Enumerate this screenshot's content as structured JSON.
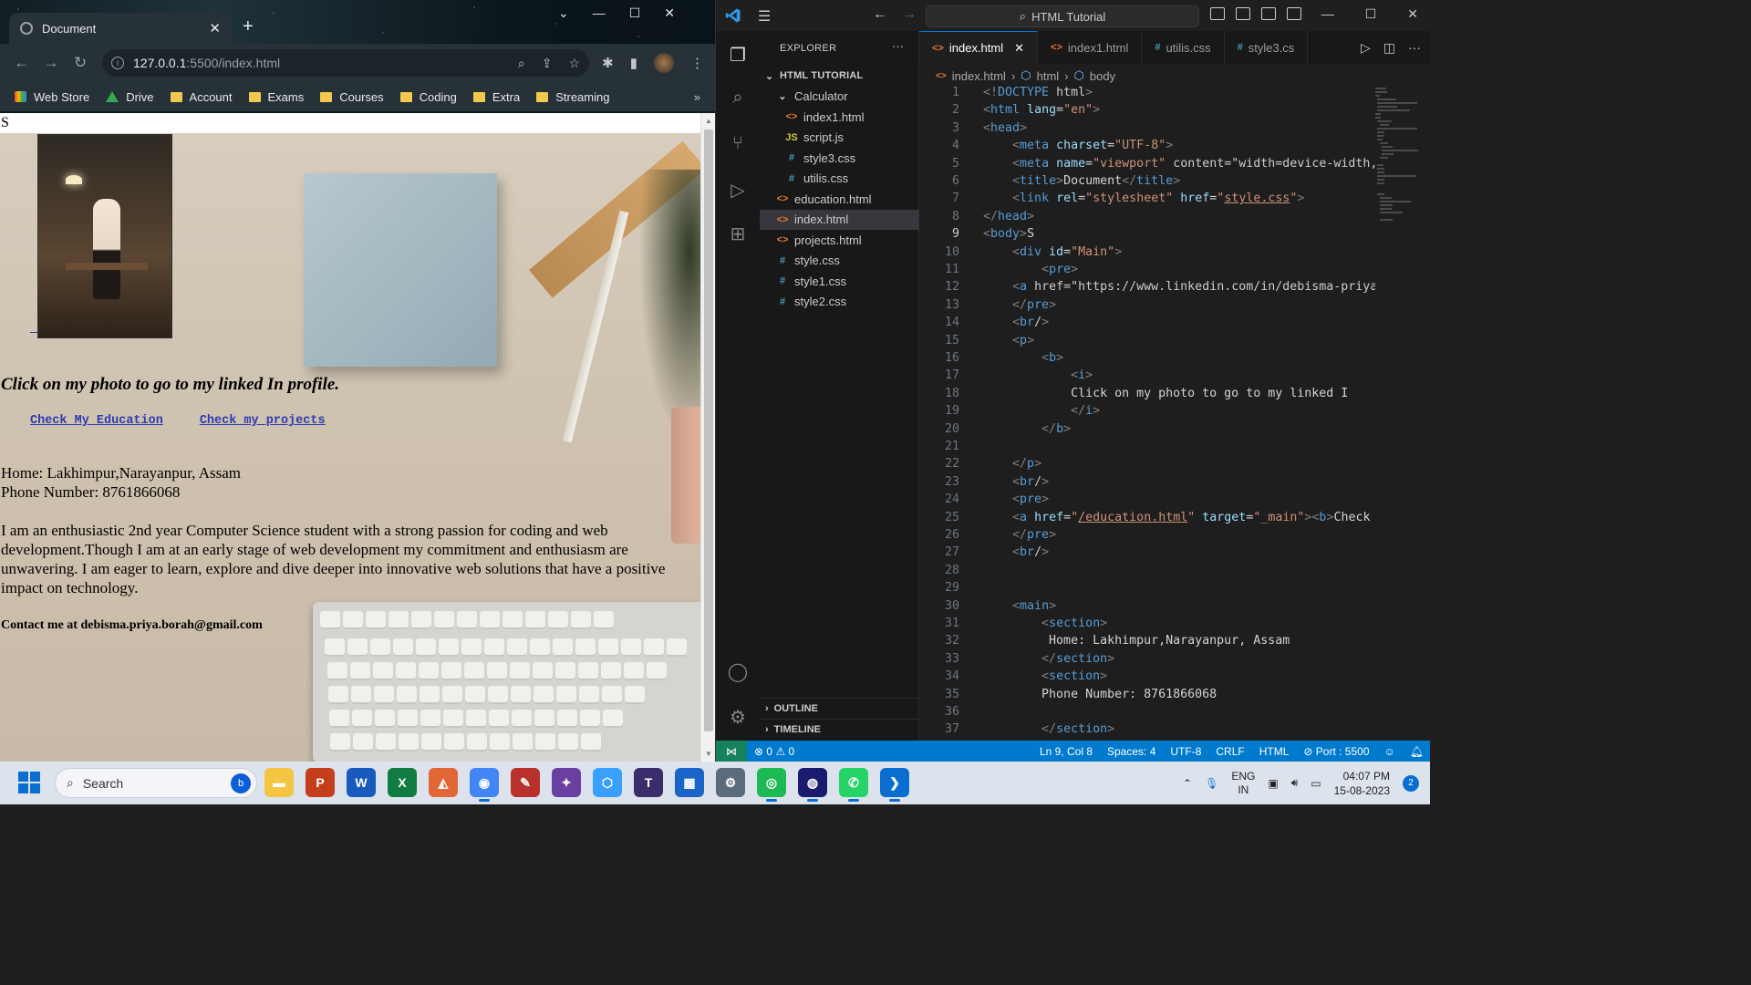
{
  "browser": {
    "tab_title": "Document",
    "url_host": "127.0.0.1",
    "url_path": ":5500/index.html",
    "bookmarks": [
      "Web Store",
      "Drive",
      "Account",
      "Exams",
      "Courses",
      "Coding",
      "Extra",
      "Streaming"
    ],
    "bookmarks_more": "»"
  },
  "page": {
    "body_text": "S",
    "intro": "Click on my photo to go to my linked In profile.",
    "link_education": "Check My Education",
    "link_projects": "Check my projects",
    "home": "Home: Lakhimpur,Narayanpur, Assam",
    "phone": "Phone Number: 8761866068",
    "about": "I am an enthusiastic 2nd year Computer Science student with a strong passion for coding and web development.Though I am at an early stage of web development my commitment and enthusiasm are unwavering. I am eager to learn, explore and dive deeper into innovative web solutions that have a positive impact on technology.",
    "contact": "Contact me at debisma.priya.borah@gmail.com"
  },
  "vscode": {
    "command_center": "HTML Tutorial",
    "explorer_title": "EXPLORER",
    "explorer_more": "···",
    "workspace": "HTML TUTORIAL",
    "tree": [
      {
        "label": "Calculator",
        "type": "folder",
        "indent": 1
      },
      {
        "label": "index1.html",
        "type": "html",
        "indent": 2
      },
      {
        "label": "script.js",
        "type": "js",
        "indent": 2
      },
      {
        "label": "style3.css",
        "type": "css",
        "indent": 2
      },
      {
        "label": "utilis.css",
        "type": "css",
        "indent": 2
      },
      {
        "label": "education.html",
        "type": "html",
        "indent": 1
      },
      {
        "label": "index.html",
        "type": "html",
        "indent": 1,
        "selected": true
      },
      {
        "label": "projects.html",
        "type": "html",
        "indent": 1
      },
      {
        "label": "style.css",
        "type": "css",
        "indent": 1
      },
      {
        "label": "style1.css",
        "type": "css",
        "indent": 1
      },
      {
        "label": "style2.css",
        "type": "css",
        "indent": 1
      }
    ],
    "outline": "OUTLINE",
    "timeline": "TIMELINE",
    "tabs": [
      {
        "label": "index.html",
        "type": "html",
        "active": true
      },
      {
        "label": "index1.html",
        "type": "html"
      },
      {
        "label": "utilis.css",
        "type": "css"
      },
      {
        "label": "style3.cs",
        "type": "css"
      }
    ],
    "breadcrumb": [
      "index.html",
      "html",
      "body"
    ],
    "current_line": 9,
    "code_lines": [
      "<!DOCTYPE html>",
      "<html lang=\"en\">",
      "<head>",
      "    <meta charset=\"UTF-8\">",
      "    <meta name=\"viewport\" content=\"width=device-width,",
      "    <title>Document</title>",
      "    <link rel=\"stylesheet\" href=\"style.css\">",
      "</head>",
      "<body>S",
      "    <div id=\"Main\">",
      "        <pre>",
      "    <a href=\"https://www.linkedin.com/in/debisma-priya",
      "    </pre>",
      "    <br/>",
      "    <p>",
      "        <b>",
      "            <i>",
      "            Click on my photo to go to my linked I",
      "            </i>",
      "        </b>",
      "",
      "    </p>",
      "    <br/>",
      "    <pre>",
      "    <a href=\"/education.html\" target=\"_main\"><b>Check",
      "    </pre>",
      "    <br/>",
      "",
      "",
      "    <main>",
      "        <section>",
      "         Home: Lakhimpur,Narayanpur, Assam",
      "        </section>",
      "        <section>",
      "        Phone Number: 8761866068",
      "",
      "        </section>"
    ],
    "status": {
      "errors": "0",
      "warnings": "0",
      "position": "Ln 9, Col 8",
      "spaces": "Spaces: 4",
      "encoding": "UTF-8",
      "eol": "CRLF",
      "language": "HTML",
      "port": "Port : 5500"
    }
  },
  "taskbar": {
    "search_placeholder": "Search",
    "apps": [
      "file-explorer",
      "powerpoint",
      "word",
      "excel",
      "matlab",
      "chrome",
      "app-red",
      "app-color",
      "app-hex",
      "tex",
      "store",
      "settings",
      "spotify",
      "zoom",
      "whatsapp",
      "vscode"
    ],
    "lang_top": "ENG",
    "lang_bottom": "IN",
    "time": "04:07 PM",
    "date": "15-08-2023",
    "notifications": "2"
  }
}
